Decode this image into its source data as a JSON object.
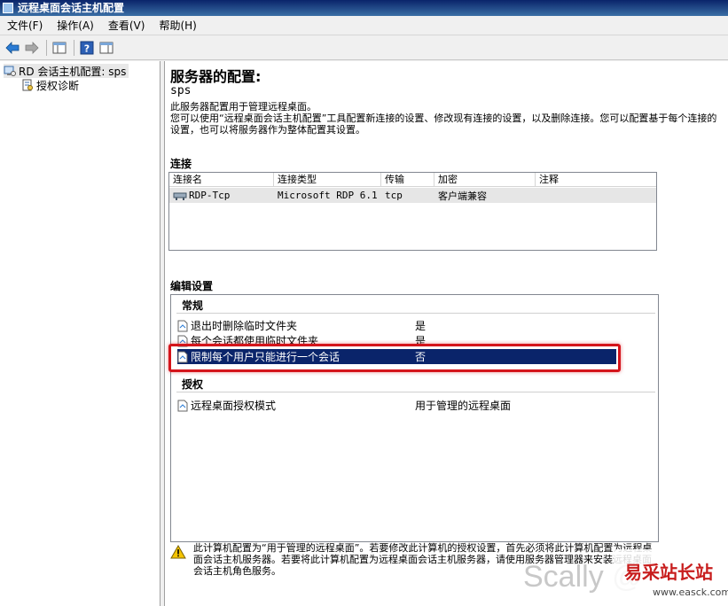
{
  "window": {
    "title": "远程桌面会话主机配置"
  },
  "menu": {
    "items": [
      "文件(F)",
      "操作(A)",
      "查看(V)",
      "帮助(H)"
    ]
  },
  "tree": {
    "root_label": "RD 会话主机配置: sps",
    "child_label": "授权诊断"
  },
  "main": {
    "title": "服务器的配置:",
    "server_name": "sps",
    "description": "此服务器配置用于管理远程桌面。\n您可以使用“远程桌面会话主机配置”工具配置新连接的设置、修改现有连接的设置，以及删除连接。您可以配置基于每个连接的设置，也可以将服务器作为整体配置其设置。"
  },
  "connections": {
    "label": "连接",
    "columns": [
      "连接名",
      "连接类型",
      "传输",
      "加密",
      "注释"
    ],
    "rows": [
      {
        "name": "RDP-Tcp",
        "type": "Microsoft RDP 6.1",
        "transport": "tcp",
        "encryption": "客户端兼容",
        "comment": ""
      }
    ]
  },
  "edit_settings": {
    "label": "编辑设置",
    "general": {
      "header": "常规",
      "items": [
        {
          "name": "退出时删除临时文件夹",
          "value": "是"
        },
        {
          "name": "每个会话都使用临时文件夹",
          "value": "是"
        },
        {
          "name": "限制每个用户只能进行一个会话",
          "value": "否"
        }
      ]
    },
    "licensing": {
      "header": "授权",
      "items": [
        {
          "name": "远程桌面授权模式",
          "value": "用于管理的远程桌面"
        }
      ]
    }
  },
  "warning_text": "此计算机配置为“用于管理的远程桌面”。若要修改此计算机的授权设置，首先必须将此计算机配置为远程桌面会话主机服务器。若要将此计算机配置为远程桌面会话主机服务器，请使用服务器管理器来安装远程桌面会话主机角色服务。",
  "overlay": {
    "watermark": "Scally @",
    "site_title": "易采站长站",
    "site_url": "www.easck.com"
  },
  "colors": {
    "titlebar": "#0a246a",
    "selection": "#0a246a",
    "highlight_border": "#d4141b",
    "warning": "#f5c400"
  }
}
